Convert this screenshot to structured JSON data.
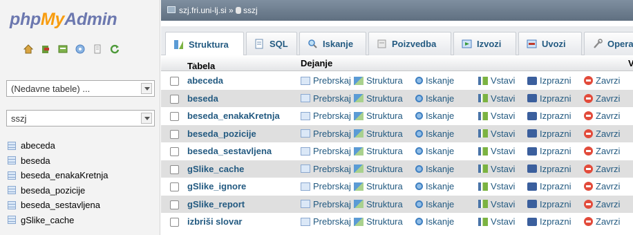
{
  "logo": {
    "php": "php",
    "my": "My",
    "admin": "Admin"
  },
  "nav_icons": [
    "home-icon",
    "exit-icon",
    "query-window-icon",
    "documentation-icon",
    "docs-page-icon",
    "reload-icon"
  ],
  "recent_tables": {
    "value": "(Nedavne tabele) ..."
  },
  "database_select": {
    "value": "sszj"
  },
  "sidebar_tables": [
    "abeceda",
    "beseda",
    "beseda_enakaKretnja",
    "beseda_pozicije",
    "beseda_sestavljena",
    "gSlike_cache"
  ],
  "breadcrumb": {
    "server": "szj.fri.uni-lj.si",
    "separator": "»",
    "database": "sszj"
  },
  "tabs": [
    {
      "label": "Struktura",
      "icon": "structure-icon"
    },
    {
      "label": "SQL",
      "icon": "sql-icon"
    },
    {
      "label": "Iskanje",
      "icon": "search-icon"
    },
    {
      "label": "Poizvedba",
      "icon": "query-icon"
    },
    {
      "label": "Izvozi",
      "icon": "export-icon"
    },
    {
      "label": "Uvozi",
      "icon": "import-icon"
    },
    {
      "label": "Opera",
      "icon": "operations-icon"
    }
  ],
  "table_header": {
    "table": "Tabela",
    "sort_indicator": "▲",
    "action": "Dejanje",
    "extra": "V"
  },
  "actions": {
    "browse": "Prebrskaj",
    "structure": "Struktura",
    "search": "Iskanje",
    "insert": "Vstavi",
    "empty": "Izprazni",
    "drop": "Zavrzi"
  },
  "rows": [
    "abeceda",
    "beseda",
    "beseda_enakaKretnja",
    "beseda_pozicije",
    "beseda_sestavljena",
    "gSlike_cache",
    "gSlike_ignore",
    "gSlike_report",
    "izbriši slovar"
  ],
  "colors": {
    "link": "#235a81",
    "header_bar": "#6f7f90",
    "row_alt": "#dfdfdf",
    "logo_blue": "#6c78af",
    "logo_orange": "#f89c0e"
  }
}
